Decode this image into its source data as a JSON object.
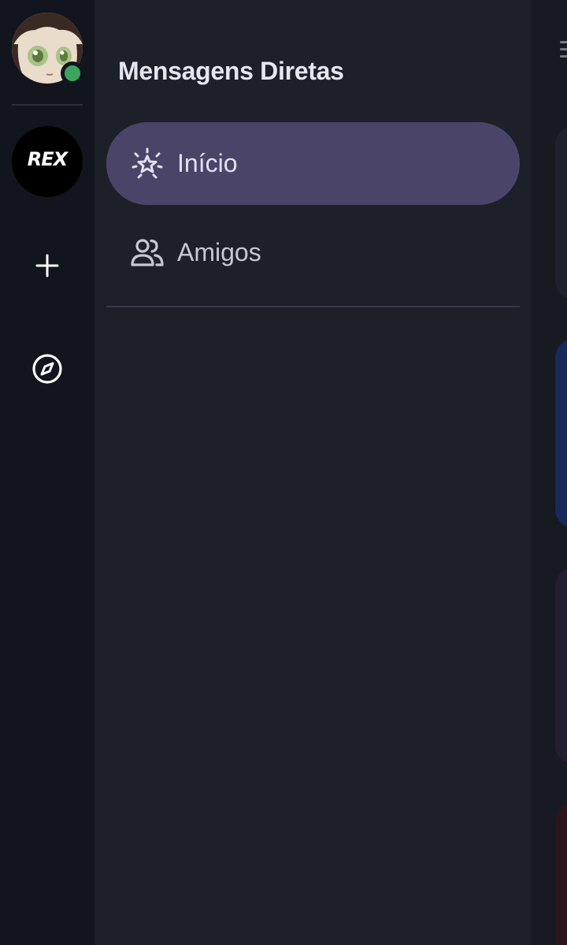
{
  "sidebar": {
    "avatar_icon": "user-avatar",
    "status": "online",
    "status_color": "#3ba55c",
    "server": {
      "logo_text": "REX",
      "icon": "rex-server-icon"
    },
    "add_icon": "plus-icon",
    "explore_icon": "compass-icon"
  },
  "panel": {
    "title": "Mensagens Diretas",
    "items": [
      {
        "label": "Início",
        "icon": "sparkle-star-icon",
        "active": true
      },
      {
        "label": "Amigos",
        "icon": "friends-icon",
        "active": false
      }
    ]
  },
  "colors": {
    "rail_bg": "#13151e",
    "panel_bg": "#1e2029",
    "active_bg": "#4a4568",
    "accent_card": "#172a5c"
  },
  "right_strip": {
    "menu_icon": "hamburger-icon"
  }
}
